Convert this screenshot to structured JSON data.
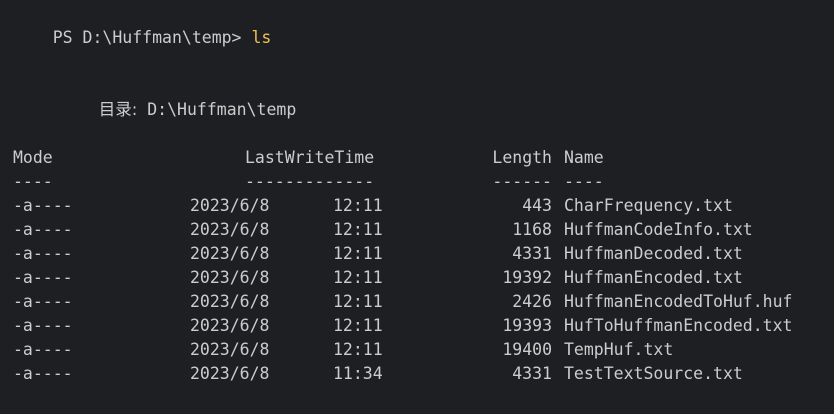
{
  "prompt": {
    "path": "PS D:\\Huffman\\temp> ",
    "command": "ls"
  },
  "directory": {
    "label": "目录:",
    "path": " D:\\Huffman\\temp"
  },
  "headers": {
    "mode": "Mode",
    "lastwritetime": "LastWriteTime",
    "length": "Length",
    "name": "Name"
  },
  "underlines": {
    "mode": "----",
    "lastwritetime": "-------------",
    "length": "------",
    "name": "----"
  },
  "rows": [
    {
      "mode": "-a----",
      "date": "2023/6/8",
      "time": "12:11",
      "length": "443",
      "name": "CharFrequency.txt"
    },
    {
      "mode": "-a----",
      "date": "2023/6/8",
      "time": "12:11",
      "length": "1168",
      "name": "HuffmanCodeInfo.txt"
    },
    {
      "mode": "-a----",
      "date": "2023/6/8",
      "time": "12:11",
      "length": "4331",
      "name": "HuffmanDecoded.txt"
    },
    {
      "mode": "-a----",
      "date": "2023/6/8",
      "time": "12:11",
      "length": "19392",
      "name": "HuffmanEncoded.txt"
    },
    {
      "mode": "-a----",
      "date": "2023/6/8",
      "time": "12:11",
      "length": "2426",
      "name": "HuffmanEncodedToHuf.huf"
    },
    {
      "mode": "-a----",
      "date": "2023/6/8",
      "time": "12:11",
      "length": "19393",
      "name": "HufToHuffmanEncoded.txt"
    },
    {
      "mode": "-a----",
      "date": "2023/6/8",
      "time": "12:11",
      "length": "19400",
      "name": "TempHuf.txt"
    },
    {
      "mode": "-a----",
      "date": "2023/6/8",
      "time": "11:34",
      "length": "4331",
      "name": "TestTextSource.txt"
    }
  ],
  "colors": {
    "background": "#1e1f22",
    "text": "#cccccc",
    "command": "#f1c24b"
  }
}
